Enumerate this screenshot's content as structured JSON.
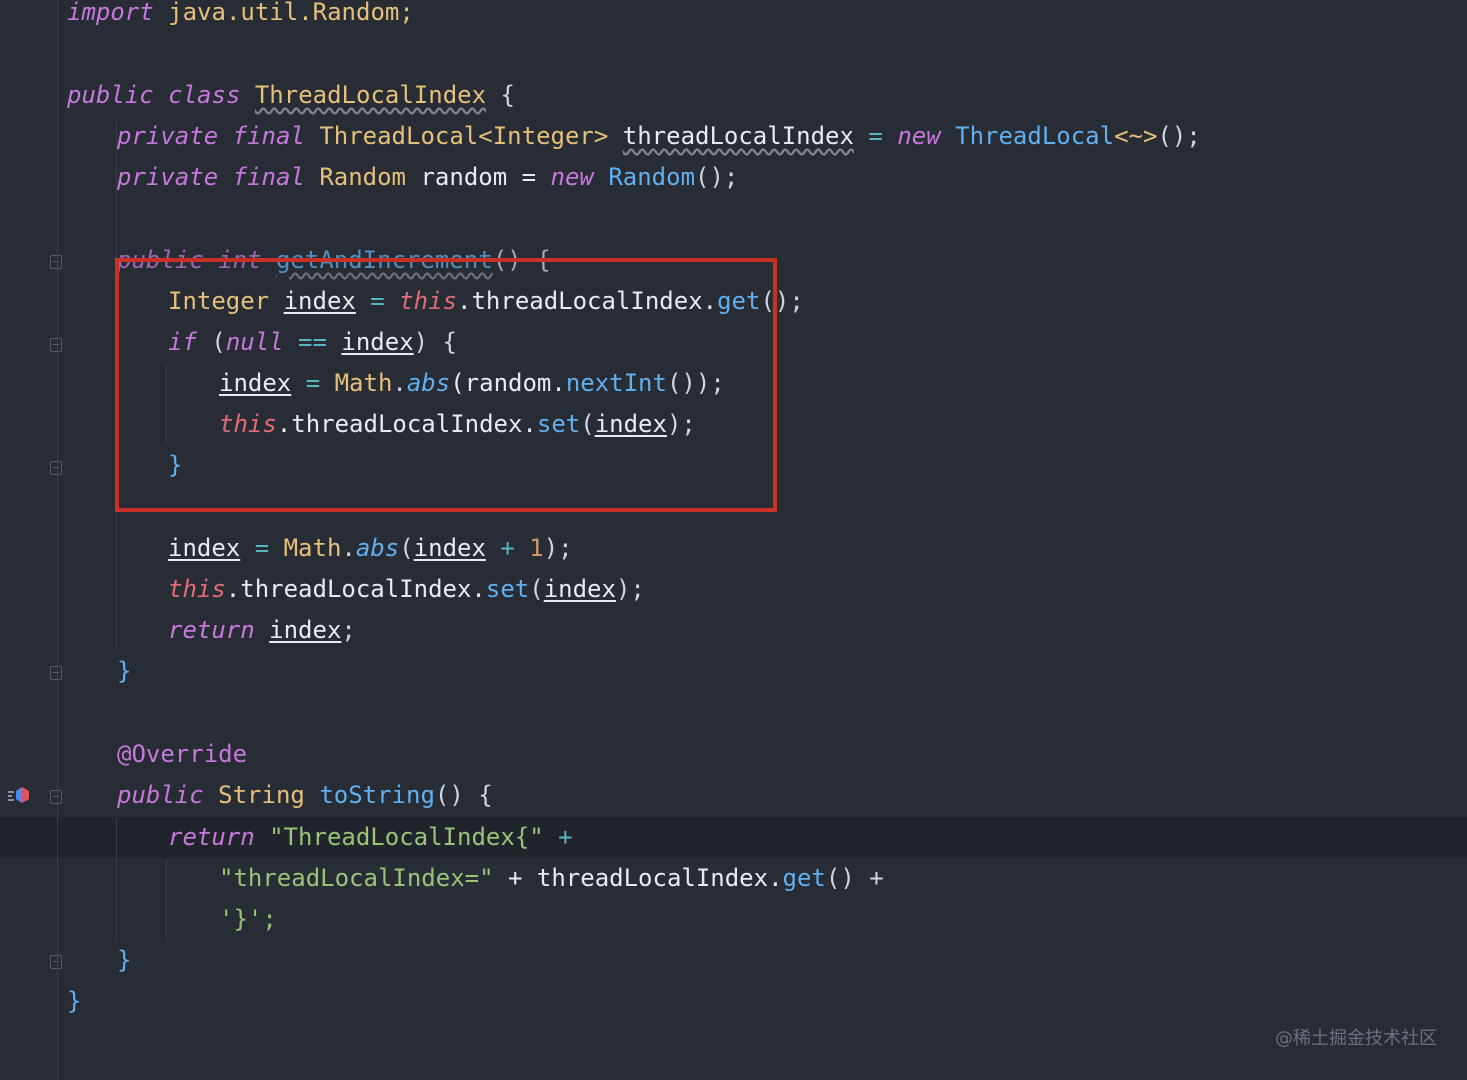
{
  "editor": {
    "lines": {
      "l01": "import",
      "l01b": " java.util.Random;",
      "l02a": "public",
      "l02b": "class",
      "l02c": "ThreadLocalIndex",
      "l02d": " {",
      "l03a": "private",
      "l03b": "final",
      "l03c": "ThreadLocal",
      "l03d": "<Integer>",
      "l03e": "threadLocalIndex",
      "l03f": " = ",
      "l03g": "new",
      "l03h": "ThreadLocal",
      "l03i": "<~>",
      "l03j": "();",
      "l04a": "private",
      "l04b": "final",
      "l04c": "Random",
      "l04d": " random = ",
      "l04e": "new",
      "l04f": "Random",
      "l04g": "();",
      "l05a": "public",
      "l05b": "int",
      "l05c": "getAndIncrement",
      "l05d": "() {",
      "l06a": "Integer",
      "l06b": "index",
      "l06c": " = ",
      "l06d": "this",
      "l06e": ".threadLocalIndex.",
      "l06f": "get",
      "l06g": "();",
      "l07a": "if",
      "l07b": " (",
      "l07c": "null",
      "l07d": " == ",
      "l07e": "index",
      "l07f": ") {",
      "l08a": "index",
      "l08b": " = ",
      "l08c": "Math",
      "l08d": ".",
      "l08e": "abs",
      "l08f": "(random.",
      "l08g": "nextInt",
      "l08h": "());",
      "l09a": "this",
      "l09b": ".threadLocalIndex.",
      "l09c": "set",
      "l09d": "(",
      "l09e": "index",
      "l09f": ");",
      "l10": "}",
      "l11a": "index",
      "l11b": " = ",
      "l11c": "Math",
      "l11d": ".",
      "l11e": "abs",
      "l11f": "(",
      "l11g": "index",
      "l11h": " + ",
      "l11i": "1",
      "l11j": ");",
      "l12a": "this",
      "l12b": ".threadLocalIndex.",
      "l12c": "set",
      "l12d": "(",
      "l12e": "index",
      "l12f": ");",
      "l13a": "return",
      "l13b": "index",
      "l13c": ";",
      "l14": "}",
      "l15": "@Override",
      "l16a": "public",
      "l16b": "String",
      "l16c": "toString",
      "l16d": "() {",
      "l17a": "return",
      "l17b": "\"ThreadLocalIndex{\"",
      "l17c": " +",
      "l18a": "\"threadLocalIndex=\"",
      "l18b": " + threadLocalIndex.",
      "l18c": "get",
      "l18d": "() +",
      "l19": "'}';",
      "l20": "}",
      "l21": "}"
    }
  },
  "watermark": "@稀土掘金技术社区",
  "colors": {
    "background": "#282c34",
    "highlight_box": "#c93026",
    "keyword": "#c678dd",
    "type": "#e5c07b",
    "function": "#61afef",
    "string": "#98c379"
  },
  "icons": {
    "fold_markers": "fold-icon",
    "override_marker": "override-gutter-icon"
  }
}
